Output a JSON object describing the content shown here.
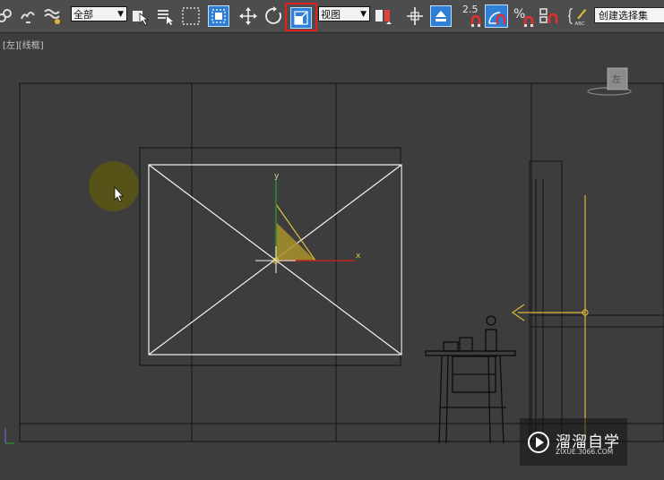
{
  "toolbar": {
    "selection_filter": "全部",
    "reference_coord": "视图",
    "snap_angle_value": "2.5",
    "percent_snap_symbol": "%",
    "named_selection_placeholder": "创建选择集"
  },
  "viewport": {
    "label": "[左][线框]",
    "viewcube_face": "左",
    "gizmo": {
      "x_axis": "x",
      "y_axis": "y"
    }
  },
  "watermark": {
    "text": "溜溜自学",
    "url": "ZIXUE.3066.COM"
  },
  "colors": {
    "toolbar_bg": "#4d4d4d",
    "viewport_bg": "#3d3d3d",
    "selected_object": "#ffffff",
    "light_yellow": "#d8b83a",
    "highlight_red": "#e02020",
    "active_blue": "#2f7fd6"
  },
  "icons": [
    "link-icon",
    "unlink-icon",
    "bind-space-warp-icon",
    "select-object-icon",
    "select-by-name-icon",
    "rectangular-region-icon",
    "window-crossing-icon",
    "move-icon",
    "rotate-icon",
    "scale-icon",
    "pivot-icon",
    "mirror-icon",
    "align-icon",
    "snaps-toggle-icon",
    "angle-snap-icon",
    "percent-snap-icon",
    "spinner-snap-icon",
    "edit-named-sets-icon"
  ]
}
